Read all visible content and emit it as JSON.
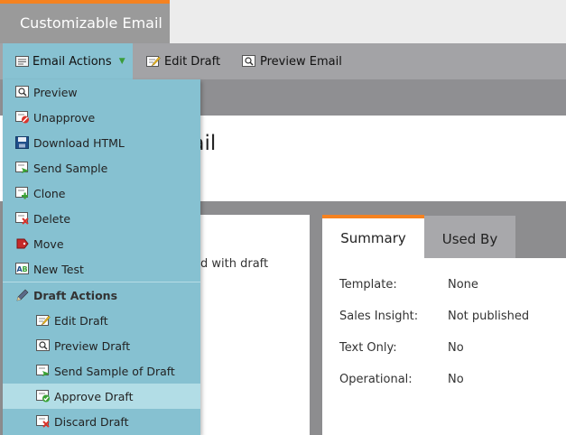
{
  "app": {
    "title": "Customizable Email"
  },
  "toolbar": {
    "email_actions": "Email Actions",
    "edit_draft": "Edit Draft",
    "preview_email": "Preview Email"
  },
  "email": {
    "title_fragment": "mail"
  },
  "notice": {
    "text": "d with draft"
  },
  "tabs": {
    "summary": "Summary",
    "used_by": "Used By"
  },
  "summary": [
    {
      "label": "Template:",
      "value": "None"
    },
    {
      "label": "Sales Insight:",
      "value": "Not published"
    },
    {
      "label": "Text Only:",
      "value": "No"
    },
    {
      "label": "Operational:",
      "value": "No"
    }
  ],
  "menu": {
    "items": [
      {
        "label": "Preview",
        "icon": "preview-icon"
      },
      {
        "label": "Unapprove",
        "icon": "unapprove-icon"
      },
      {
        "label": "Download HTML",
        "icon": "download-html-icon"
      },
      {
        "label": "Send Sample",
        "icon": "send-sample-icon"
      },
      {
        "label": "Clone",
        "icon": "clone-icon"
      },
      {
        "label": "Delete",
        "icon": "delete-icon"
      },
      {
        "label": "Move",
        "icon": "move-icon"
      },
      {
        "label": "New Test",
        "icon": "new-test-icon"
      }
    ],
    "draft_header": "Draft Actions",
    "draft_items": [
      {
        "label": "Edit Draft",
        "icon": "edit-draft-icon"
      },
      {
        "label": "Preview Draft",
        "icon": "preview-draft-icon"
      },
      {
        "label": "Send Sample of Draft",
        "icon": "send-sample-draft-icon"
      },
      {
        "label": "Approve Draft",
        "icon": "approve-draft-icon",
        "highlighted": true
      },
      {
        "label": "Discard Draft",
        "icon": "discard-draft-icon"
      }
    ]
  },
  "colors": {
    "accent": "#f58220",
    "menu_bg": "#86c1d1",
    "menu_highlight": "#b2dde6",
    "toolbar_bg": "#a3a3a6"
  }
}
